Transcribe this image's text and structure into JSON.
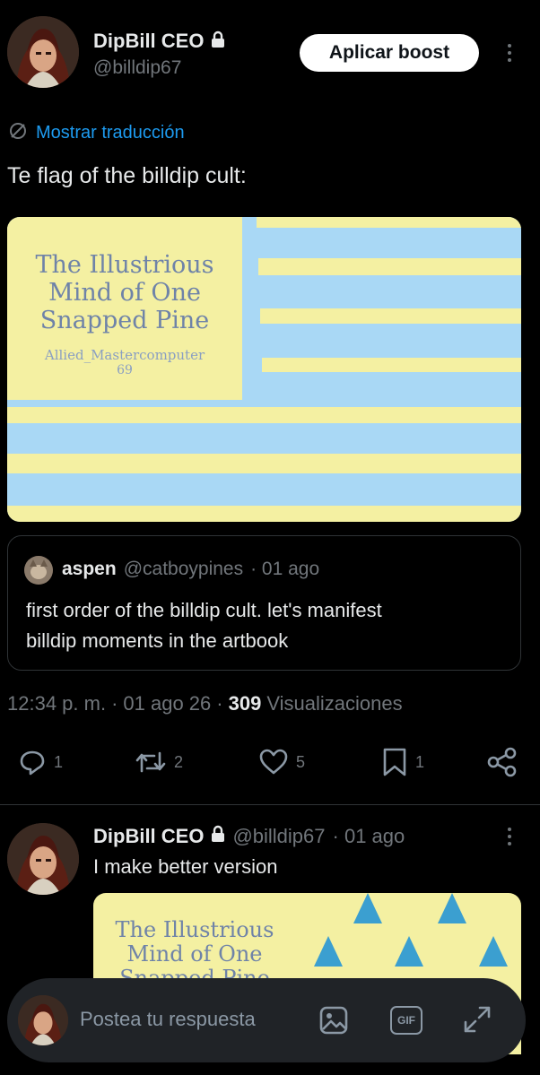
{
  "post": {
    "display_name": "DipBill CEO",
    "handle": "@billdip67",
    "boost_label": "Aplicar boost",
    "translate_label": "Mostrar traducción",
    "text": "Te flag of the billdip cult:",
    "image_text": {
      "line1": "The Illustrious",
      "line2": "Mind of One",
      "line3": "Snapped Pine",
      "author": "Allied_Mastercomputer",
      "number": "69"
    },
    "time": "12:34 p. m.",
    "date": "01 ago 26",
    "views_count": "309",
    "views_label": "Visualizaciones"
  },
  "quote": {
    "display_name": "aspen",
    "handle": "@catboypines",
    "date": "· 01 ago",
    "text_line1": "first order of the billdip cult. let's manifest",
    "text_line2": "billdip moments in the artbook"
  },
  "actions": {
    "replies": "1",
    "reposts": "2",
    "likes": "5",
    "bookmarks": "1"
  },
  "reply": {
    "display_name": "DipBill CEO",
    "handle": "@billdip67",
    "date": "· 01 ago",
    "text": "I make better version",
    "image_text": {
      "line1": "The Illustrious",
      "line2": "Mind of One",
      "line3": "Snapped Pine"
    }
  },
  "composer": {
    "placeholder": "Postea tu respuesta",
    "gif_label": "GIF"
  },
  "colors": {
    "accent_link": "#1d9bf0",
    "flag_blue": "#a9d8f5",
    "flag_yellow": "#f4f0a2",
    "flag_text": "#6f83a8",
    "triangle": "#3b9fd0"
  }
}
